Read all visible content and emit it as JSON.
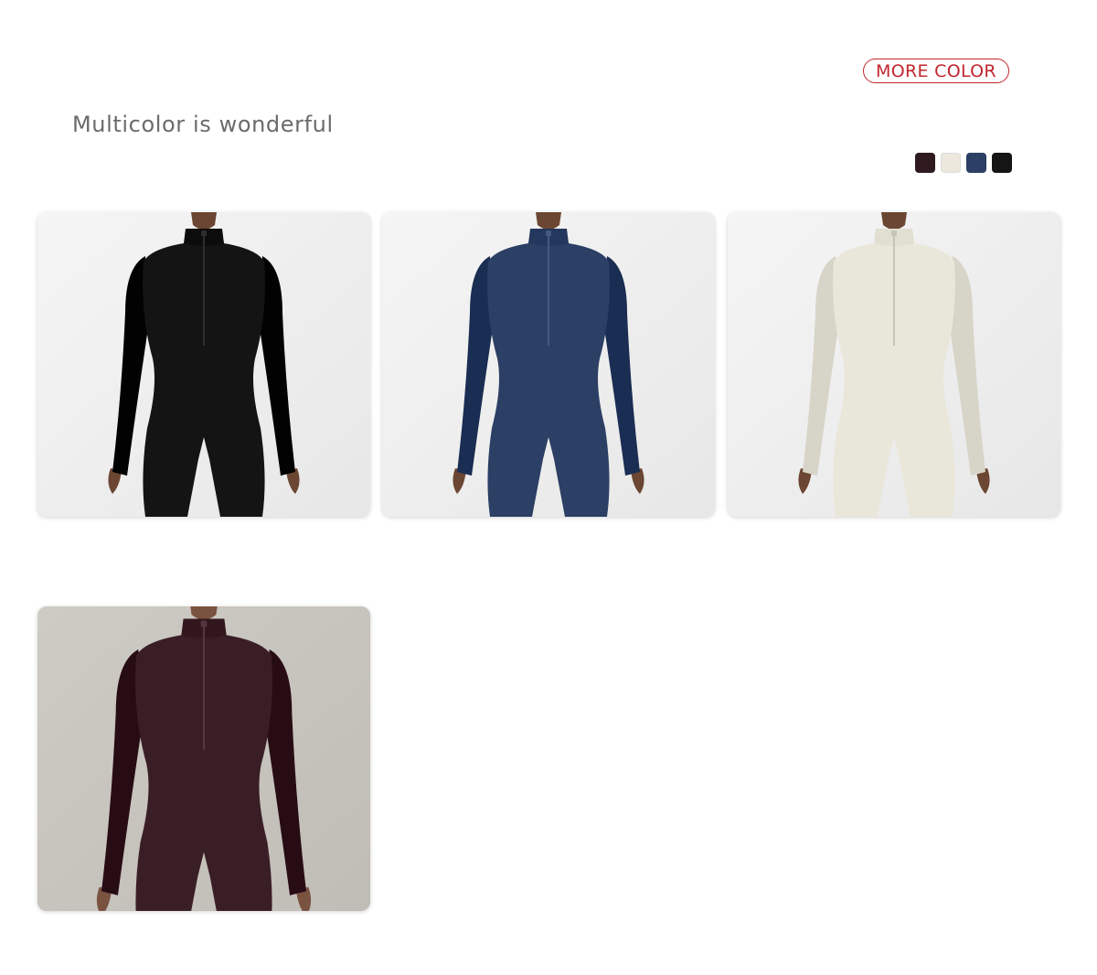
{
  "header": {
    "more_color_label": "MORE COLOR",
    "headline": "Multicolor is wonderful"
  },
  "swatches": [
    {
      "color": "#2e1a1f"
    },
    {
      "color": "#ece8dd"
    },
    {
      "color": "#2c3f64"
    },
    {
      "color": "#151515"
    }
  ],
  "products": [
    {
      "garment_color": "#141414",
      "background": "#efefef",
      "skin": "#6b4632"
    },
    {
      "garment_color": "#2c3f64",
      "background": "#efefef",
      "skin": "#6b4632"
    },
    {
      "garment_color": "#e9e6da",
      "background": "#efefef",
      "skin": "#6b4632"
    },
    {
      "garment_color": "#3a1e26",
      "background": "#c8c4be",
      "skin": "#7a5240"
    }
  ],
  "brand": {
    "accent": "#c0262d"
  }
}
